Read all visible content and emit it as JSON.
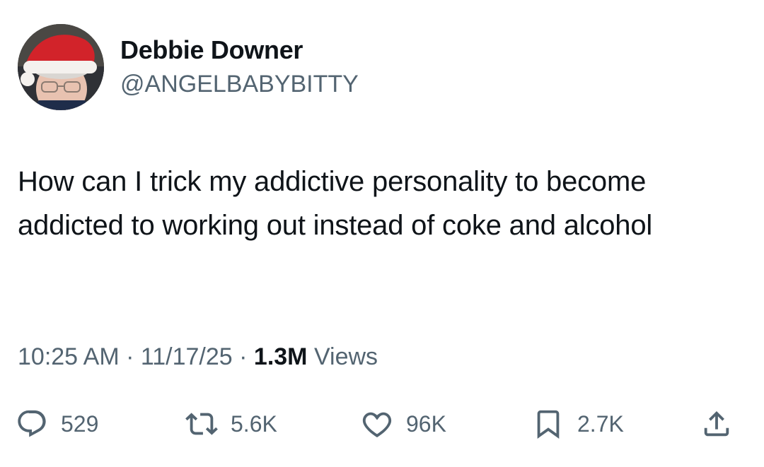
{
  "author": {
    "display_name": "Debbie Downer",
    "handle": "@ANGELBABYBITTY"
  },
  "tweet": {
    "text": "How can I trick my addictive personality to become addicted to working out instead of coke and alcohol"
  },
  "meta": {
    "time": "10:25 AM",
    "separator1": " · ",
    "date": "11/17/25",
    "separator2": " · ",
    "views_count": "1.3M",
    "views_label": " Views"
  },
  "actions": {
    "replies": "529",
    "reposts": "5.6K",
    "likes": "96K",
    "bookmarks": "2.7K"
  },
  "icons": {
    "reply": "reply-icon",
    "repost": "repost-icon",
    "like": "heart-icon",
    "bookmark": "bookmark-icon",
    "share": "share-icon"
  },
  "colors": {
    "text_primary": "#0f1419",
    "text_secondary": "#536471",
    "icon": "#536471"
  }
}
